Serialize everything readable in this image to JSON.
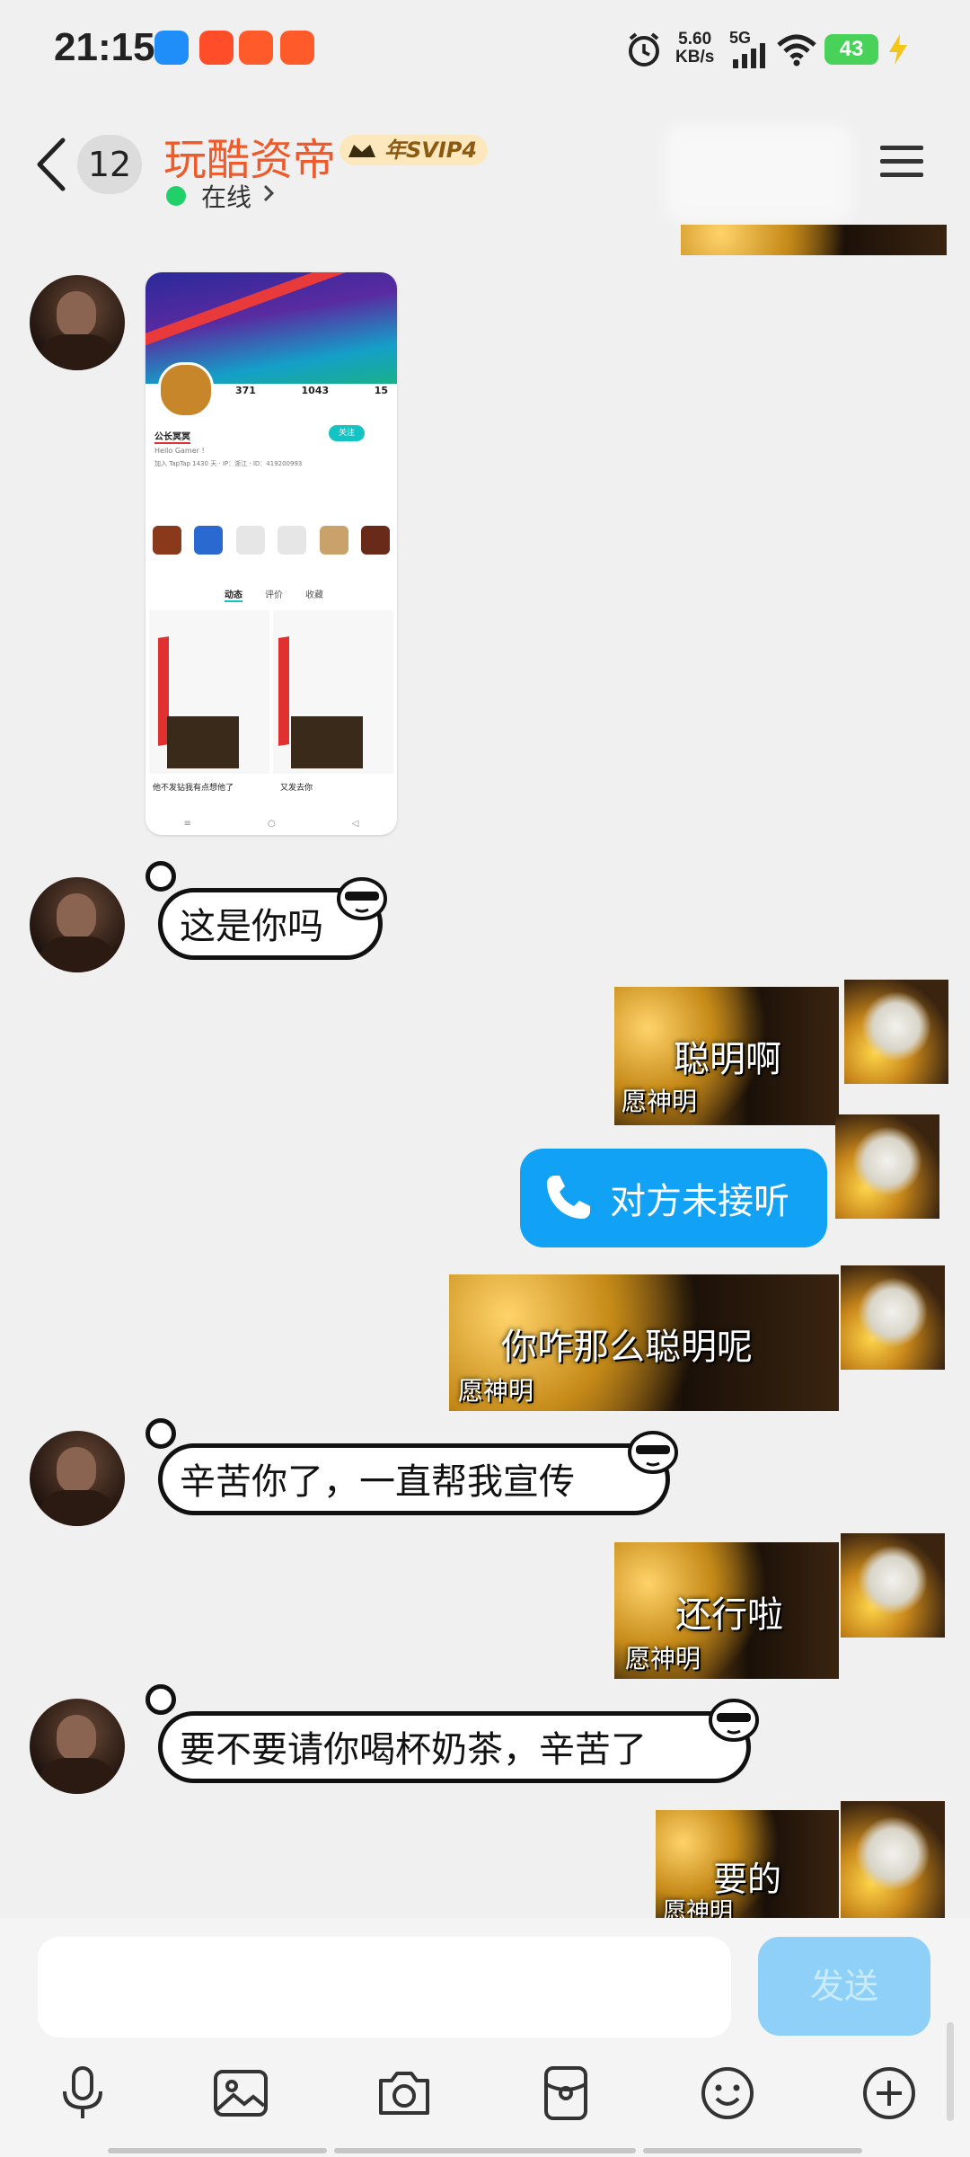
{
  "status_bar": {
    "time": "21:15",
    "net_speed_value": "5.60",
    "net_speed_unit": "KB/s",
    "network": "5G",
    "battery": "43"
  },
  "header": {
    "unread_count": "12",
    "contact_name": "玩酷资帝",
    "vip_label": "年SVIP4",
    "status": "在线"
  },
  "shared_screenshot": {
    "stats": [
      {
        "value": "371"
      },
      {
        "value": "1043"
      },
      {
        "value": "15"
      }
    ],
    "profile_name": "公长冥冥",
    "tagline": "Hello Gamer !",
    "info": "加入 TapTap 1430 天 · IP：浙江 · ID：419200993",
    "follow_btn": "关注",
    "tabs": [
      "动态",
      "评价",
      "收藏"
    ],
    "post_captions": [
      "他不发钻我有点想他了",
      "又发去你"
    ]
  },
  "messages": [
    {
      "side": "left",
      "type": "sticker",
      "text": "这是你吗"
    },
    {
      "side": "right",
      "type": "sticker",
      "text": "聪明啊",
      "sub": "愿神明"
    },
    {
      "side": "right",
      "type": "call",
      "text": "对方未接听"
    },
    {
      "side": "right",
      "type": "sticker",
      "text": "你咋那么聪明呢",
      "sub": "愿神明"
    },
    {
      "side": "left",
      "type": "sticker",
      "text": "辛苦你了，一直帮我宣传"
    },
    {
      "side": "right",
      "type": "sticker",
      "text": "还行啦",
      "sub": "愿神明"
    },
    {
      "side": "left",
      "type": "sticker",
      "text": "要不要请你喝杯奶茶，辛苦了"
    },
    {
      "side": "right",
      "type": "sticker",
      "text": "要的",
      "sub": "愿神明"
    }
  ],
  "input": {
    "placeholder": "",
    "send_label": "发送"
  },
  "colors": {
    "accent_blue": "#11a2f5",
    "name_orange": "#ef5a2a",
    "online_green": "#22d06a"
  }
}
